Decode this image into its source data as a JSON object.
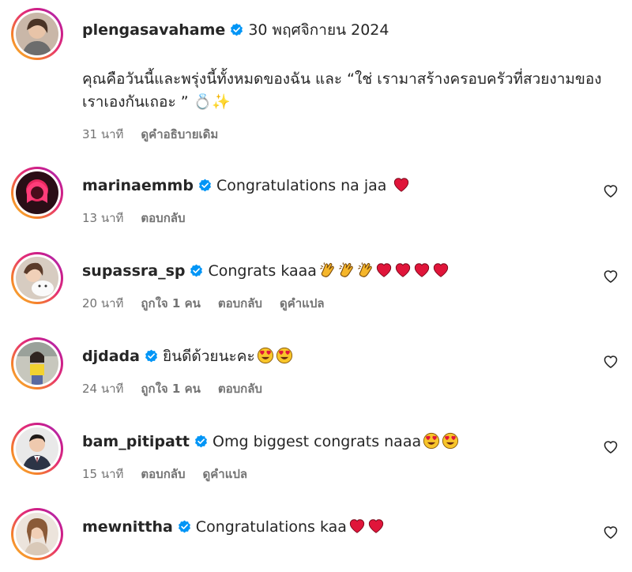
{
  "caption_post": {
    "username": "plengasavahame",
    "date": "30 พฤศจิกายน 2024",
    "caption": "คุณคือวันนี้และพรุ่งนี้ทั้งหมดของฉัน และ “ใช่ เรามาสร้างครอบครัวที่สวยงามของเราเองกันเถอะ ” 💍✨",
    "time": "31 นาที",
    "see_original": "ดูคำอธิบายเดิม"
  },
  "comments": [
    {
      "username": "marinaemmb",
      "text": "Congratulations na jaa ",
      "emojis": [
        "heart-emoji"
      ],
      "time": "13 นาที",
      "likes": "",
      "reply": "ตอบกลับ",
      "translate": ""
    },
    {
      "username": "supassra_sp",
      "text": "Congrats kaaa",
      "emojis": [
        "clap-emoji",
        "clap-emoji",
        "clap-emoji",
        "heart-emoji",
        "heart-emoji",
        "heart-emoji",
        "heart-emoji"
      ],
      "time": "20 นาที",
      "likes": "ถูกใจ 1 คน",
      "reply": "ตอบกลับ",
      "translate": "ดูคำแปล"
    },
    {
      "username": "djdada",
      "text": "ยินดีด้วยนะคะ",
      "emojis": [
        "heart-eyes-emoji",
        "heart-eyes-emoji"
      ],
      "time": "24 นาที",
      "likes": "ถูกใจ 1 คน",
      "reply": "ตอบกลับ",
      "translate": ""
    },
    {
      "username": "bam_pitipatt",
      "text": "Omg biggest congrats naaa",
      "emojis": [
        "heart-eyes-emoji",
        "heart-eyes-emoji"
      ],
      "time": "15 นาที",
      "likes": "",
      "reply": "ตอบกลับ",
      "translate": "ดูคำแปล"
    },
    {
      "username": "mewnittha",
      "text": "Congratulations kaa",
      "emojis": [
        "heart-emoji",
        "heart-emoji"
      ],
      "time": "",
      "likes": "",
      "reply": "",
      "translate": ""
    }
  ],
  "colors": {
    "verified_blue": "#0095f6",
    "text": "#262626",
    "secondary_text": "#737373",
    "heart_red": "#e0153a"
  }
}
